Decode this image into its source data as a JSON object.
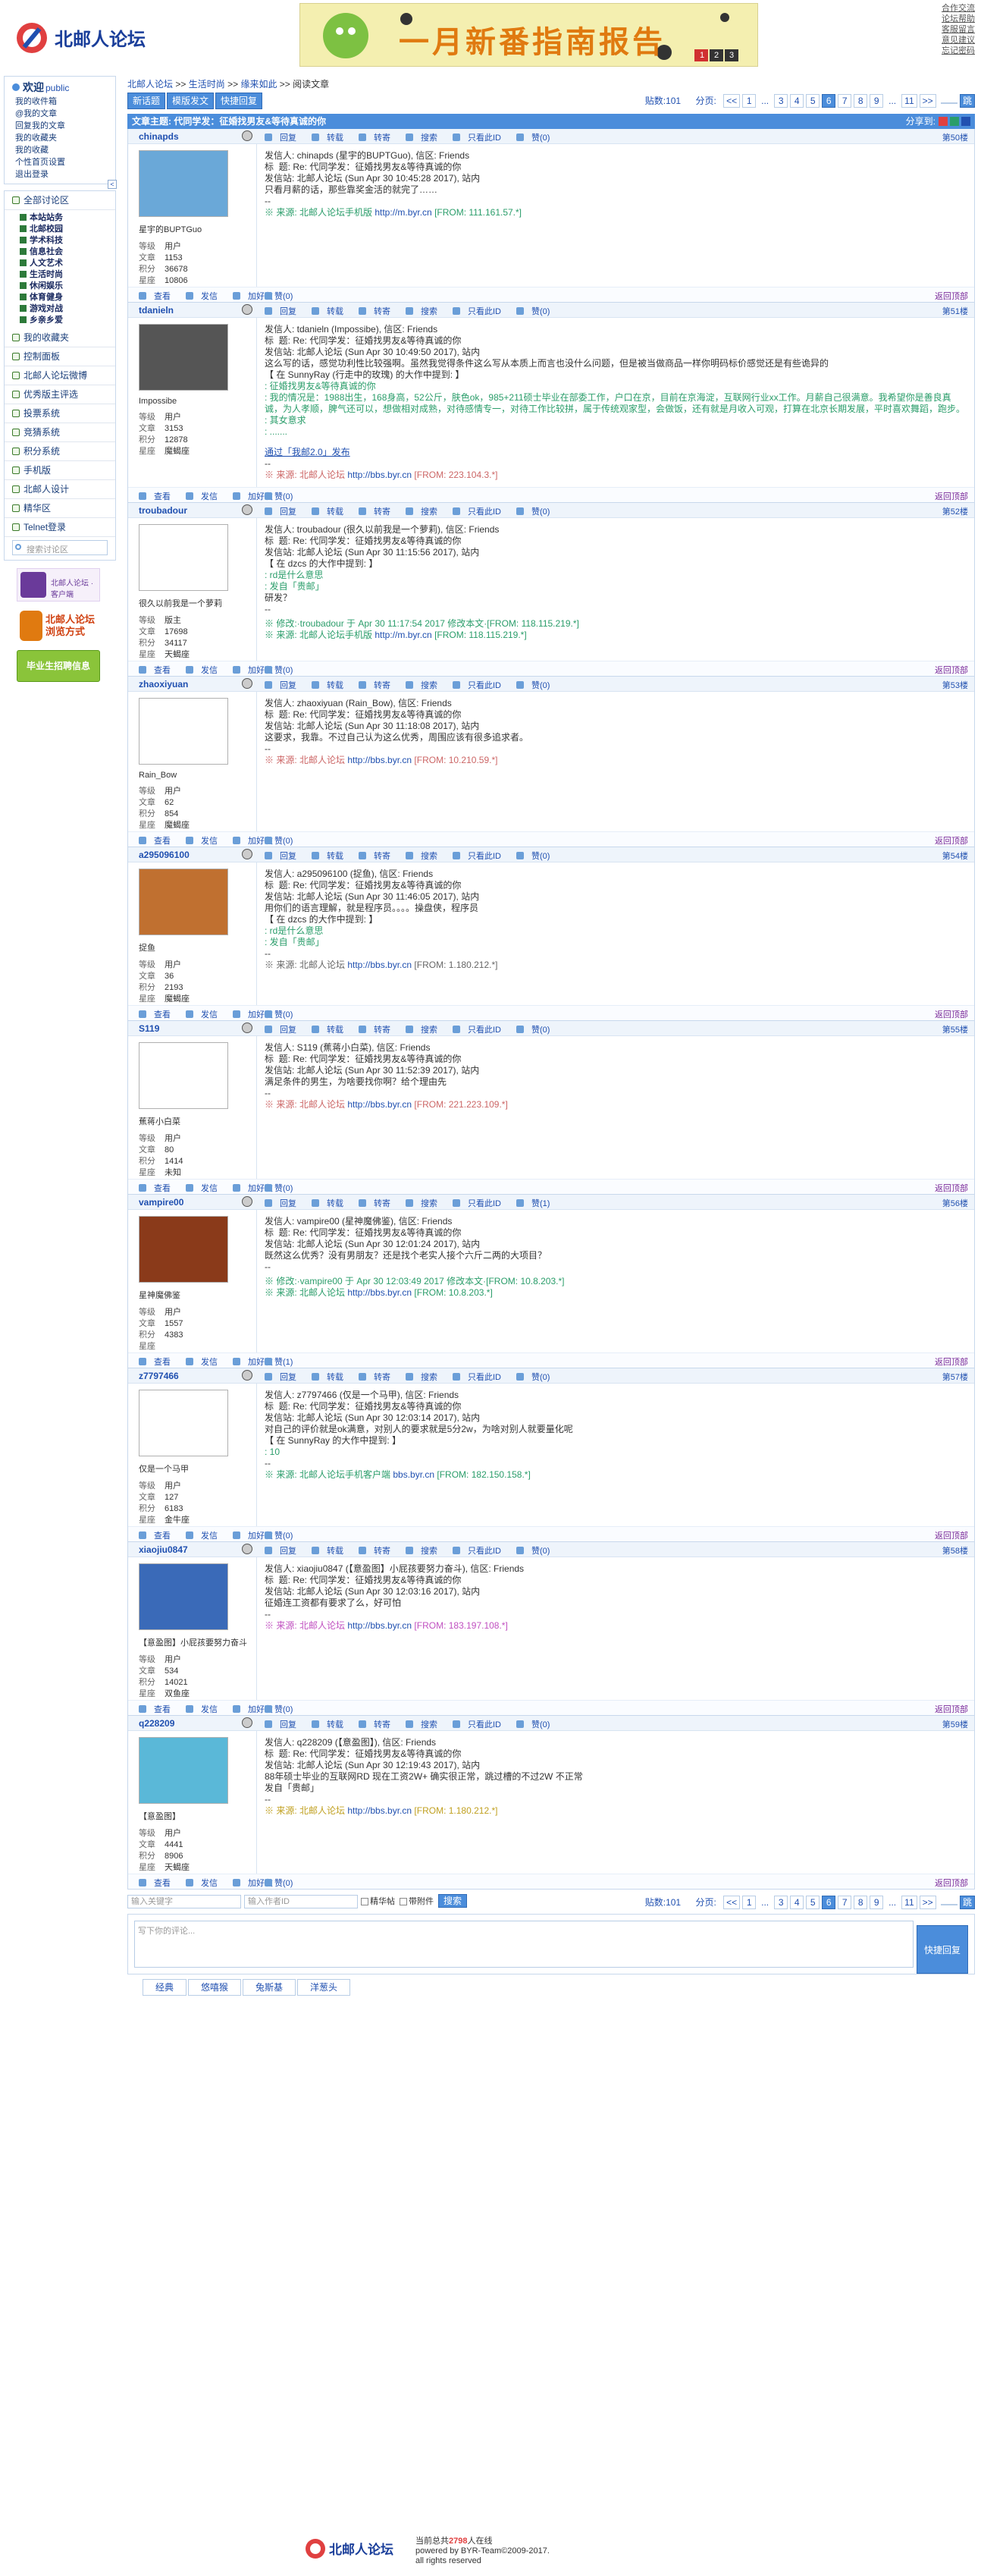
{
  "header": {
    "logo_text": "北邮人论坛",
    "banner_text": "一月新番指南报告",
    "banner_pages": [
      "1",
      "2",
      "3"
    ],
    "links": [
      "合作交流",
      "论坛帮助",
      "客服留言",
      "意见建议",
      "忘记密码"
    ]
  },
  "sidebar": {
    "welcome": "欢迎",
    "username": "public",
    "user_links": [
      "我的收件箱",
      "@我的文章",
      "回复我的文章",
      "我的收藏夹",
      "我的收藏",
      "个性首页设置",
      "退出登录"
    ],
    "all_boards": "全部讨论区",
    "boards": [
      "本站站务",
      "北邮校园",
      "学术科技",
      "信息社会",
      "人文艺术",
      "生活时尚",
      "休闲娱乐",
      "体育健身",
      "游戏对战",
      "乡亲乡爱"
    ],
    "sections": [
      "我的收藏夹",
      "控制面板",
      "北邮人论坛微博",
      "优秀版主评选",
      "投票系统",
      "竞猜系统",
      "积分系统",
      "手机版",
      "北邮人设计",
      "精华区",
      "Telnet登录"
    ],
    "search_placeholder": "搜索讨论区",
    "promos": [
      "北邮人论坛 · 客户端",
      "北邮人论坛 浏览方式",
      "毕业生招聘信息"
    ]
  },
  "breadcrumb": [
    "北邮人论坛",
    ">>",
    "生活时尚",
    ">>",
    "缘来如此",
    ">>",
    "阅读文章"
  ],
  "toolbar": {
    "buttons": [
      "新话题",
      "模版发文",
      "快捷回复"
    ],
    "reply_count_label": "贴数:101",
    "page_label": "分页:",
    "pages": [
      "<<",
      "1",
      "...",
      "3",
      "4",
      "5",
      "6",
      "7",
      "8",
      "9",
      "...",
      "11",
      ">>"
    ],
    "current_page": "6"
  },
  "thread_title": "文章主题: 代同学发：征婚找男友&等待真诚的你",
  "share_label": "分享到:",
  "posts": [
    {
      "user": "chinapds",
      "display": "星宇的BUPTGuo",
      "level": "用户",
      "posts": "1153",
      "score": "36678",
      "rank": "10806",
      "floor": "第50楼",
      "lines": [
        "发信人: chinapds (星宇的BUPTGuo), 信区: Friends",
        "标  题: Re: 代同学发：征婚找男友&等待真诚的你",
        "发信站: 北邮人论坛 (Sun Apr 30 10:45:28 2017), 站内",
        "",
        "只看月薪的话，那些靠奖金活的就完了……",
        "--"
      ],
      "source": "※ 来源: 北邮人论坛手机版 ",
      "source_link": "http://m.byr.cn",
      "ip": "[FROM: 111.161.57.*]",
      "source_style": "g",
      "like": "赞(0)"
    },
    {
      "user": "tdanieln",
      "display": "Impossibe",
      "level": "用户",
      "posts": "3153",
      "score": "12878",
      "rank": "魔蝎座",
      "floor": "第51楼",
      "lines": [
        "发信人: tdanieln (Impossibe), 信区: Friends",
        "标  题: Re: 代同学发：征婚找男友&等待真诚的你",
        "发信站: 北邮人论坛 (Sun Apr 30 10:49:50 2017), 站内",
        "",
        "这么写的话，感觉功利性比较强啊。虽然我觉得条件这么写从本质上而言也没什么问题，但是被当做商品一样你明码标价感觉还是有些诡异的",
        "",
        "【 在 SunnyRay (行走中的玫瑰) 的大作中提到: 】"
      ],
      "quote": [
        ": 征婚找男友&等待真诚的你",
        ": 我的情况是：1988出生，168身高，52公斤，肤色ok，985+211硕士毕业在部委工作，户口在京，目前在京海淀，互联网行业xx工作。月薪自己很满意。我希望你是善良真诚，为人孝顺，脾气还可以，想做相对成熟，对待感情专一，对待工作比较拼，属于传统观家型，会做饭，还有就是月收入可观，打算在北京长期发展，平时喜欢舞蹈，跑步。",
        ": 其女意求",
        ": ......."
      ],
      "extra": "通过「我邮2.0」发布",
      "source": "※ 来源: 北邮人论坛 ",
      "source_link": "http://bbs.byr.cn",
      "ip": "[FROM: 223.104.3.*]",
      "source_style": "r",
      "like": "赞(0)"
    },
    {
      "user": "troubadour",
      "display": "很久以前我是一个萝莉",
      "level": "版主",
      "posts": "17698",
      "score": "34117",
      "rank": "天蝎座",
      "floor": "第52楼",
      "lines": [
        "发信人: troubadour (很久以前我是一个萝莉), 信区: Friends",
        "标  题: Re: 代同学发：征婚找男友&等待真诚的你",
        "发信站: 北邮人论坛 (Sun Apr 30 11:15:56 2017), 站内",
        "",
        "【 在 dzcs 的大作中提到: 】"
      ],
      "quote": [
        ": rd是什么意思",
        "",
        ": 发自「贵邮」"
      ],
      "tail": [
        "研发？",
        "--"
      ],
      "modified": "※ 修改:·troubadour 于 Apr 30 11:17:54 2017 修改本文·[FROM: 118.115.219.*]",
      "source": "※ 来源: 北邮人论坛手机版 ",
      "source_link": "http://m.byr.cn",
      "ip": "[FROM: 118.115.219.*]",
      "source_style": "g",
      "like": "赞(0)"
    },
    {
      "user": "zhaoxiyuan",
      "display": "Rain_Bow",
      "level": "用户",
      "posts": "62",
      "score": "854",
      "rank": "魔蝎座",
      "floor": "第53楼",
      "lines": [
        "发信人: zhaoxiyuan (Rain_Bow), 信区: Friends",
        "标  题: Re: 代同学发：征婚找男友&等待真诚的你",
        "发信站: 北邮人论坛 (Sun Apr 30 11:18:08 2017), 站内",
        "",
        "这要求，我靠。不过自己认为这么优秀，周围应该有很多追求者。",
        "--"
      ],
      "source": "※ 来源: 北邮人论坛 ",
      "source_link": "http://bbs.byr.cn",
      "ip": "[FROM: 10.210.59.*]",
      "source_style": "r",
      "like": "赞(0)"
    },
    {
      "user": "a295096100",
      "display": "捉鱼",
      "level": "用户",
      "posts": "36",
      "score": "2193",
      "rank": "魔蝎座",
      "floor": "第54楼",
      "lines": [
        "发信人: a295096100 (捉鱼), 信区: Friends",
        "标  题: Re: 代同学发：征婚找男友&等待真诚的你",
        "发信站: 北邮人论坛 (Sun Apr 30 11:46:05 2017), 站内",
        "",
        "用你们的语言理解，就是程序员。。。。操盘侠，程序员",
        "",
        "【 在 dzcs 的大作中提到: 】"
      ],
      "quote": [
        ": rd是什么意思",
        "",
        ": 发自「贵邮」"
      ],
      "tail": [
        "",
        "--"
      ],
      "source": "※ 来源: 北邮人论坛 ",
      "source_link": "http://bbs.byr.cn",
      "ip": "[FROM: 1.180.212.*]",
      "source_style": "gray",
      "like": "赞(0)"
    },
    {
      "user": "S119",
      "display": "蕉蒋小白菜",
      "level": "用户",
      "posts": "80",
      "score": "1414",
      "rank": "未知",
      "floor": "第55楼",
      "lines": [
        "发信人: S119 (蕉蒋小白菜), 信区: Friends",
        "标  题: Re: 代同学发：征婚找男友&等待真诚的你",
        "发信站: 北邮人论坛 (Sun Apr 30 11:52:39 2017), 站内",
        "",
        "满足条件的男生，为啥要找你啊？给个理由先",
        "--"
      ],
      "source": "※ 来源: 北邮人论坛 ",
      "source_link": "http://bbs.byr.cn",
      "ip": "[FROM: 221.223.109.*]",
      "source_style": "r",
      "like": "赞(0)"
    },
    {
      "user": "vampire00",
      "display": "星神魔佛鉴",
      "level": "用户",
      "posts": "1557",
      "score": "4383",
      "rank": "",
      "floor": "第56楼",
      "lines": [
        "发信人: vampire00 (星神魔佛鉴), 信区: Friends",
        "标  题: Re: 代同学发：征婚找男友&等待真诚的你",
        "发信站: 北邮人论坛 (Sun Apr 30 12:01:24 2017), 站内",
        "",
        "既然这么优秀？没有男朋友？还是找个老实人接个六斤二两的大项目？",
        "--"
      ],
      "modified": "※ 修改:·vampire00 于 Apr 30 12:03:49 2017 修改本文·[FROM: 10.8.203.*]",
      "source": "※ 来源: 北邮人论坛 ",
      "source_link": "http://bbs.byr.cn",
      "ip": "[FROM: 10.8.203.*]",
      "source_style": "g",
      "like": "赞(1)"
    },
    {
      "user": "z7797466",
      "display": "仅是一个马甲",
      "level": "用户",
      "posts": "127",
      "score": "6183",
      "rank": "金牛座",
      "floor": "第57楼",
      "lines": [
        "发信人: z7797466 (仅是一个马甲), 信区: Friends",
        "标  题: Re: 代同学发：征婚找男友&等待真诚的你",
        "发信站: 北邮人论坛 (Sun Apr 30 12:03:14 2017), 站内",
        "",
        "对自己的评价就是ok满意，对别人的要求就是5分2w，为啥对别人就要量化呢",
        "【 在 SunnyRay 的大作中提到: 】"
      ],
      "quote": [
        ": 10"
      ],
      "tail": [
        "--"
      ],
      "source": "※ 来源: 北邮人论坛手机客户端 ",
      "source_link": "bbs.byr.cn",
      "ip": "[FROM: 182.150.158.*]",
      "source_style": "g",
      "like": "赞(0)"
    },
    {
      "user": "xiaojiu0847",
      "display": "【意盈图】小屁孩要努力奋斗",
      "level": "用户",
      "posts": "534",
      "score": "14021",
      "rank": "双鱼座",
      "floor": "第58楼",
      "lines": [
        "发信人: xiaojiu0847 (【意盈图】小屁孩要努力奋斗), 信区: Friends",
        "标  题: Re: 代同学发：征婚找男友&等待真诚的你",
        "发信站: 北邮人论坛 (Sun Apr 30 12:03:16 2017), 站内",
        "",
        "征婚连工资都有要求了么，好可怕",
        "--"
      ],
      "source": "※ 来源: 北邮人论坛 ",
      "source_link": "http://bbs.byr.cn",
      "ip": "[FROM: 183.197.108.*]",
      "source_style": "p",
      "like": "赞(0)"
    },
    {
      "user": "q228209",
      "display": "【意盈图】",
      "level": "用户",
      "posts": "4441",
      "score": "8906",
      "rank": "天蝎座",
      "floor": "第59楼",
      "lines": [
        "发信人: q228209 (【意盈图】), 信区: Friends",
        "标  题: Re: 代同学发：征婚找男友&等待真诚的你",
        "发信站: 北邮人论坛 (Sun Apr 30 12:19:43 2017), 站内",
        "",
        "88年硕士毕业的互联网RD 现在工资2W+ 确实很正常，跳过槽的不过2W 不正常",
        "",
        "发自「贵邮」",
        "--"
      ],
      "source": "※ 来源: 北邮人论坛 ",
      "source_link": "http://bbs.byr.cn",
      "ip": "[FROM: 1.180.212.*]",
      "source_style": "y",
      "like": "赞(0)"
    }
  ],
  "post_labels": {
    "level": "等级",
    "posts": "文章",
    "score": "积分",
    "rank": "星座"
  },
  "post_tools": [
    "回复",
    "转载",
    "转寄",
    "搜索",
    "只看此ID",
    "赞(0)"
  ],
  "foot_tools": [
    "查看",
    "发信",
    "加好友"
  ],
  "back_top": "返回顶部",
  "bottom": {
    "search_key_placeholder": "输入关键字",
    "search_user_placeholder": "输入作者ID",
    "opt1": "精华帖",
    "opt2": "带附件",
    "search_btn": "搜索",
    "reply_placeholder": "写下你的评论...",
    "submit": "快捷回复",
    "emoticons": [
      "经典",
      "悠嘻猴",
      "兔斯基",
      "洋葱头"
    ]
  },
  "footer": {
    "online_prefix": "当前总共",
    "online_count": "2798",
    "online_suffix": "人在线",
    "powered": "powered by BYR-Team©2009-2017.",
    "rights": "all rights reserved"
  }
}
